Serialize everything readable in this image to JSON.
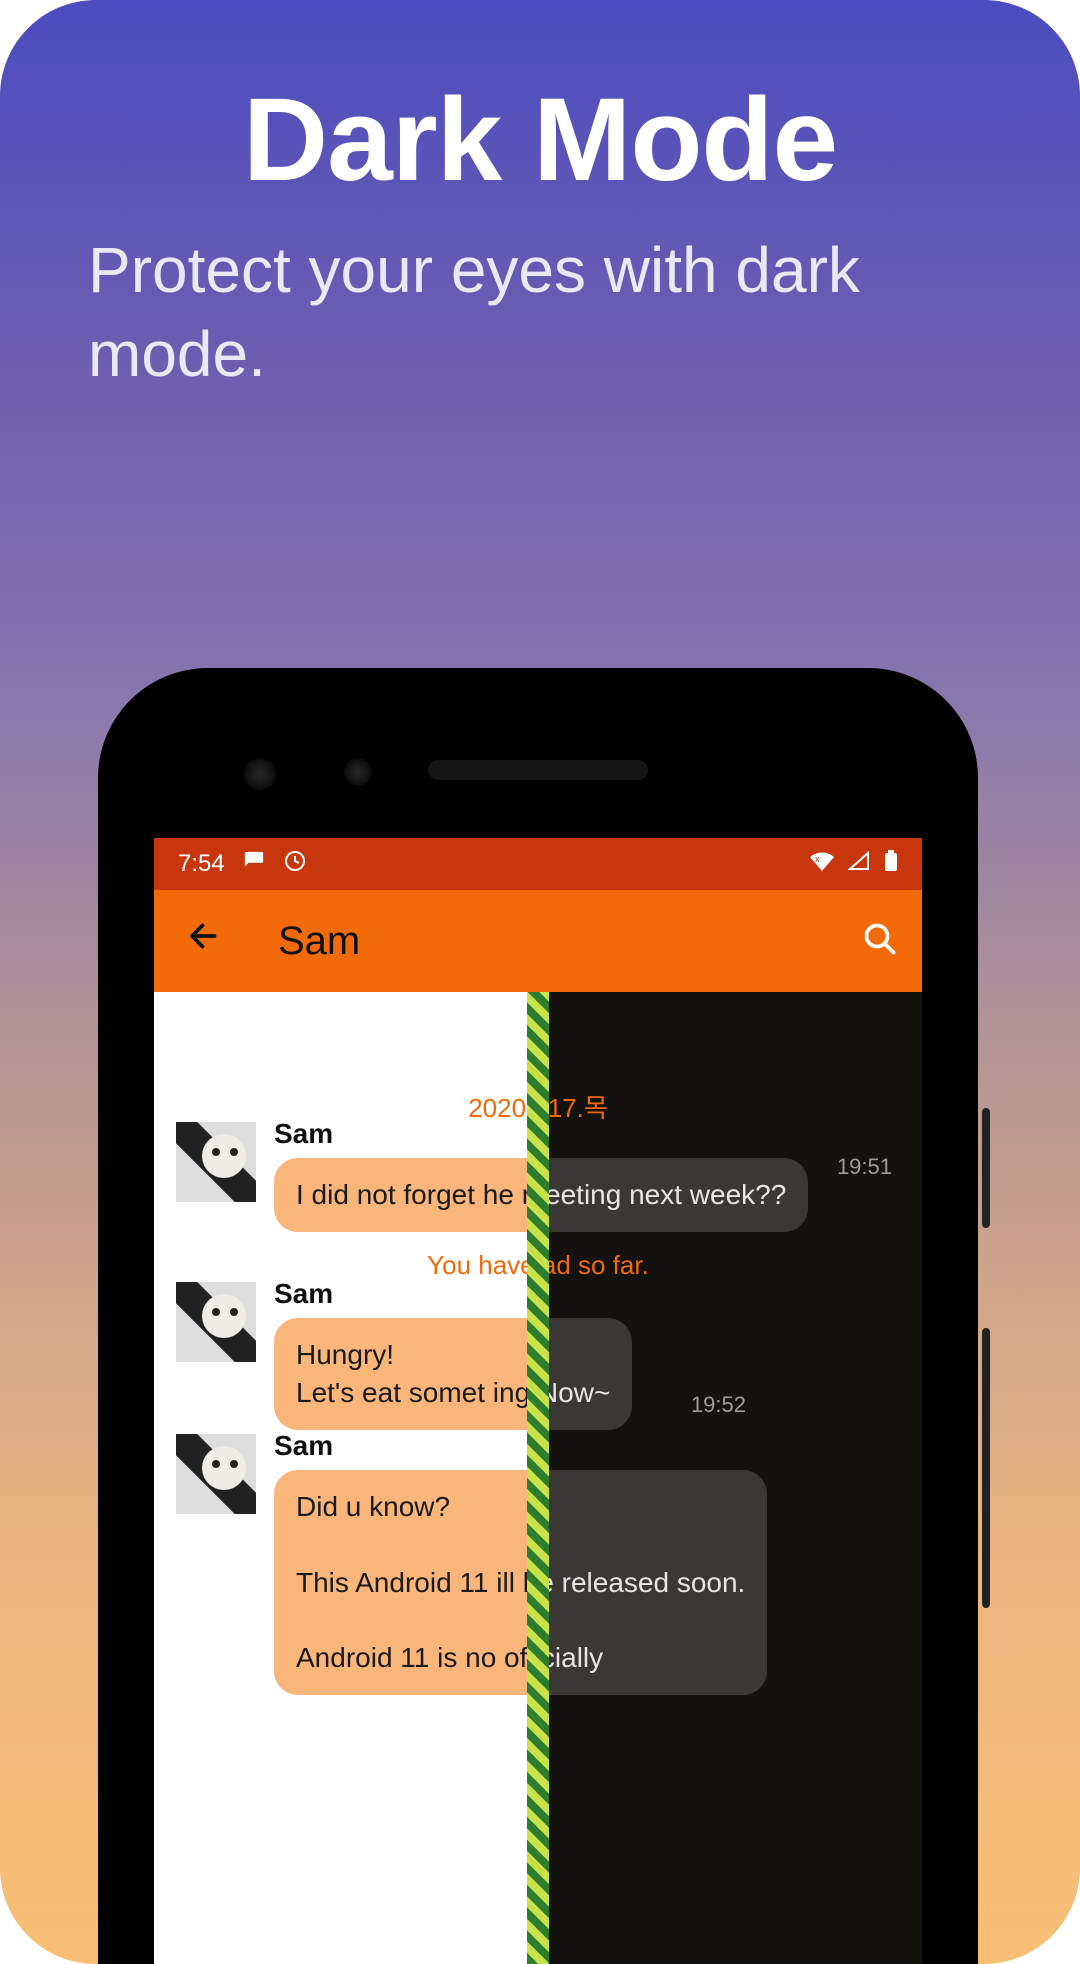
{
  "promo": {
    "title": "Dark Mode",
    "subtitle": "Protect your eyes with dark mode."
  },
  "statusbar": {
    "time": "7:54"
  },
  "appbar": {
    "contact_name": "Sam"
  },
  "chat": {
    "date_header": "2020.  .17.목",
    "read_marker": "You have  ad so far.",
    "messages": [
      {
        "sender": "Sam",
        "body": "I did not forget  he meeting next week??",
        "time": "19:51"
      },
      {
        "sender": "Sam",
        "body": "Hungry!\nLet's eat somet  ing Now~",
        "time": "19:52"
      },
      {
        "sender": "Sam",
        "body": "Did u know?\n\nThis Android 11  ill be released soon.\n\nAndroid 11 is no   officially",
        "time": ""
      }
    ]
  }
}
